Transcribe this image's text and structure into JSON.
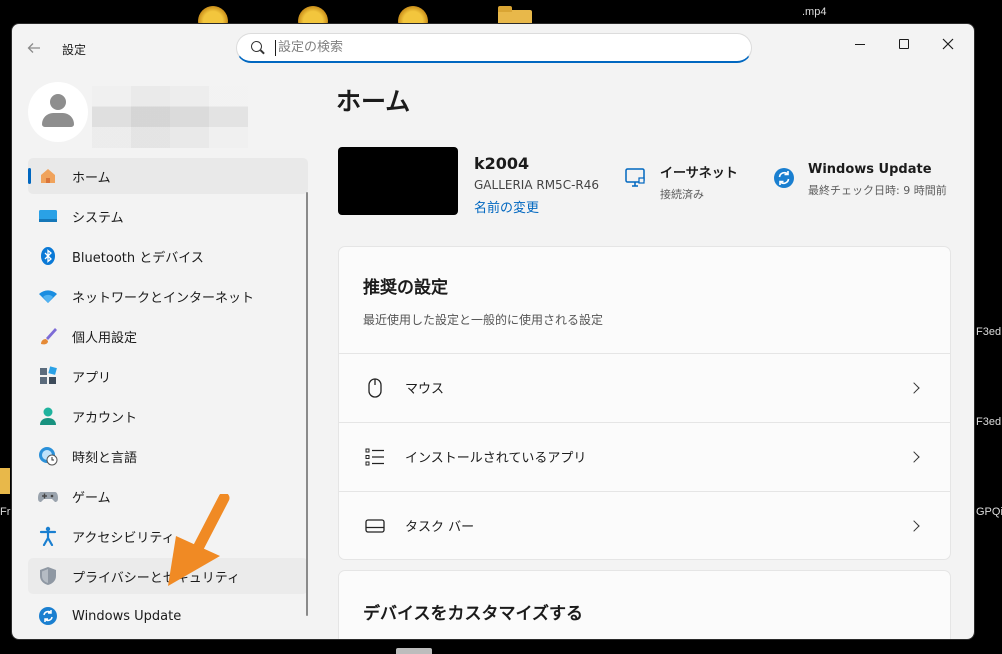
{
  "desktop": {
    "labels": {
      "mp4": ".mp4",
      "f3ed_1": "F3ed",
      "f3ed_2": "F3ed",
      "gpqi": "GPQi",
      "fr": "Fr"
    }
  },
  "window": {
    "title": "設定",
    "search": {
      "placeholder": "設定の検索",
      "value": ""
    }
  },
  "sidebar": {
    "items": [
      {
        "label": "ホーム",
        "icon": "home-icon",
        "active": true
      },
      {
        "label": "システム",
        "icon": "system-icon"
      },
      {
        "label": "Bluetooth とデバイス",
        "icon": "bluetooth-icon"
      },
      {
        "label": "ネットワークとインターネット",
        "icon": "wifi-icon"
      },
      {
        "label": "個人用設定",
        "icon": "brush-icon"
      },
      {
        "label": "アプリ",
        "icon": "apps-icon"
      },
      {
        "label": "アカウント",
        "icon": "account-icon"
      },
      {
        "label": "時刻と言語",
        "icon": "time-language-icon"
      },
      {
        "label": "ゲーム",
        "icon": "gamepad-icon"
      },
      {
        "label": "アクセシビリティ",
        "icon": "accessibility-icon"
      },
      {
        "label": "プライバシーとセキュリティ",
        "icon": "shield-icon",
        "hover": true
      },
      {
        "label": "Windows Update",
        "icon": "windows-update-icon"
      }
    ]
  },
  "main": {
    "page_title": "ホーム",
    "device": {
      "name": "k2004",
      "model": "GALLERIA RM5C-R46",
      "rename_link": "名前の変更"
    },
    "network": {
      "title": "イーサネット",
      "status": "接続済み",
      "icon": "ethernet-icon"
    },
    "update": {
      "title": "Windows Update",
      "status": "最終チェック日時: 9 時間前",
      "icon": "sync-icon"
    },
    "recommended": {
      "title": "推奨の設定",
      "subtitle": "最近使用した設定と一般的に使用される設定",
      "rows": [
        {
          "label": "マウス",
          "icon": "mouse-icon"
        },
        {
          "label": "インストールされているアプリ",
          "icon": "list-icon"
        },
        {
          "label": "タスク バー",
          "icon": "taskbar-icon"
        }
      ]
    },
    "customize": {
      "title": "デバイスをカスタマイズする"
    }
  },
  "colors": {
    "accent": "#0067c0",
    "annotation_arrow": "#f08a24",
    "window_bg": "#f3f3f3",
    "card_bg": "#fbfbfb"
  }
}
